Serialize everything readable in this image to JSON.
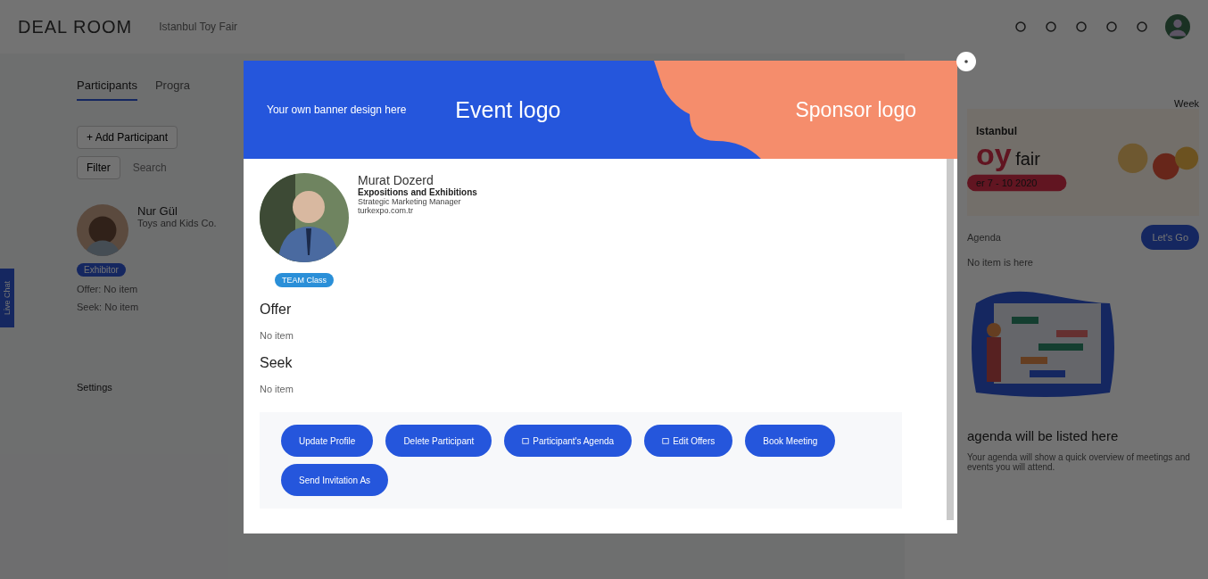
{
  "header": {
    "logo": "DEAL ROOM",
    "event": "Istanbul Toy Fair"
  },
  "tabs": [
    {
      "label": "Participants",
      "selected": true
    },
    {
      "label": "Progra",
      "selected": false
    }
  ],
  "toolbar": {
    "add": "+ Add Participant",
    "filter": "Filter",
    "search_placeholder": "Search"
  },
  "participant": {
    "name": "Nur Gül",
    "title": "Toys and Kids Co.",
    "tag": "Exhibitor",
    "offer": "Offer: No item",
    "seek": "Seek: No item"
  },
  "settings": "Settings",
  "side_tab": "Live Chat",
  "right_panel": {
    "tab": "Week",
    "banner": [
      "Istanbul",
      "oy",
      "fair",
      "er 7 - 10 2020"
    ],
    "agenda": "Agenda",
    "go": "Let's Go",
    "note": "No item is here",
    "empty_title": "agenda will be listed here",
    "empty_text": "Your agenda will show a quick overview of meetings and events you will attend."
  },
  "modal": {
    "banner_text": "Your own banner design here",
    "event_logo": "Event logo",
    "sponsor_logo": "Sponsor logo",
    "profile": {
      "name": "Murat Dozerd",
      "company": "Expositions and Exhibitions",
      "role": "Strategic Marketing Manager",
      "site": "turkexpo.com.tr",
      "tag": "TEAM Class"
    },
    "sections": [
      {
        "title": "Offer",
        "text": "No item"
      },
      {
        "title": "Seek",
        "text": "No item"
      }
    ],
    "buttons": [
      {
        "label": "Update Profile",
        "icon": false
      },
      {
        "label": "Delete Participant",
        "icon": false
      },
      {
        "label": "Participant's Agenda",
        "icon": true
      },
      {
        "label": "Edit Offers",
        "icon": true
      },
      {
        "label": "Book Meeting",
        "icon": false
      },
      {
        "label": "Send Invitation As",
        "icon": false
      }
    ]
  }
}
